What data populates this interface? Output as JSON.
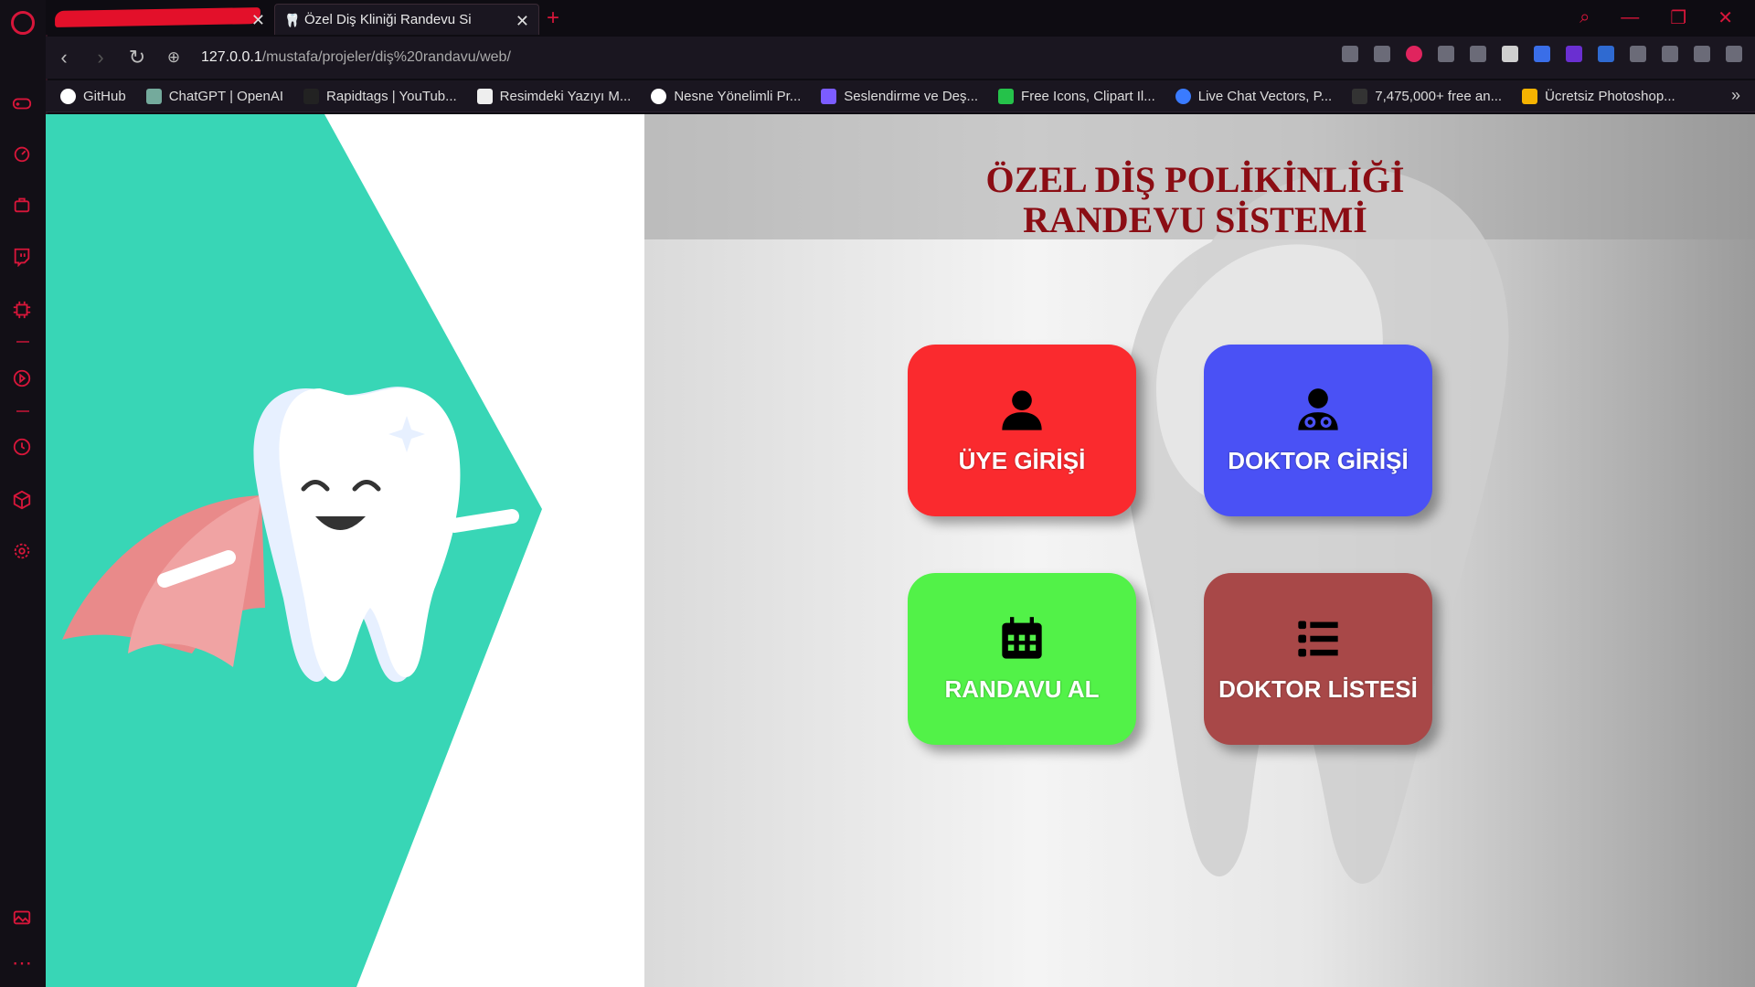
{
  "browser": {
    "tabs": [
      {
        "title": ""
      },
      {
        "title": "Özel Diş Kliniği Randevu Si"
      }
    ],
    "url": {
      "host": "127.0.0.1",
      "path": "/mustafa/projeler/diş%20randavu/web/"
    },
    "bookmarks": [
      {
        "label": "GitHub",
        "color": "#ffffff"
      },
      {
        "label": "ChatGPT | OpenAI",
        "color": "#74aa9c"
      },
      {
        "label": "Rapidtags | YouTub...",
        "color": "#222222"
      },
      {
        "label": "Resimdeki Yazıyı M...",
        "color": "#eeeeee"
      },
      {
        "label": "Nesne Yönelimli Pr...",
        "color": "#ffffff"
      },
      {
        "label": "Seslendirme ve Deş...",
        "color": "#7b5cff"
      },
      {
        "label": "Free Icons, Clipart Il...",
        "color": "#25c24a"
      },
      {
        "label": "Live Chat Vectors, P...",
        "color": "#3a7bff"
      },
      {
        "label": "7,475,000+ free an...",
        "color": "#333333"
      },
      {
        "label": "Ücretsiz Photoshop...",
        "color": "#f5b301"
      }
    ]
  },
  "page": {
    "heading_line1": "ÖZEL DİŞ POLİKİNLİĞİ",
    "heading_line2": "RANDEVU SİSTEMİ",
    "tiles": [
      {
        "label": "ÜYE GİRİŞİ",
        "icon": "user-icon",
        "color": "#fa2a2e"
      },
      {
        "label": "DOKTOR GİRİŞİ",
        "icon": "doctor-icon",
        "color": "#4a51f5"
      },
      {
        "label": "RANDAVU AL",
        "icon": "calendar-icon",
        "color": "#52f248"
      },
      {
        "label": "DOKTOR LİSTESİ",
        "icon": "list-icon",
        "color": "#a84848"
      }
    ],
    "accent_color": "#38d6b6"
  }
}
